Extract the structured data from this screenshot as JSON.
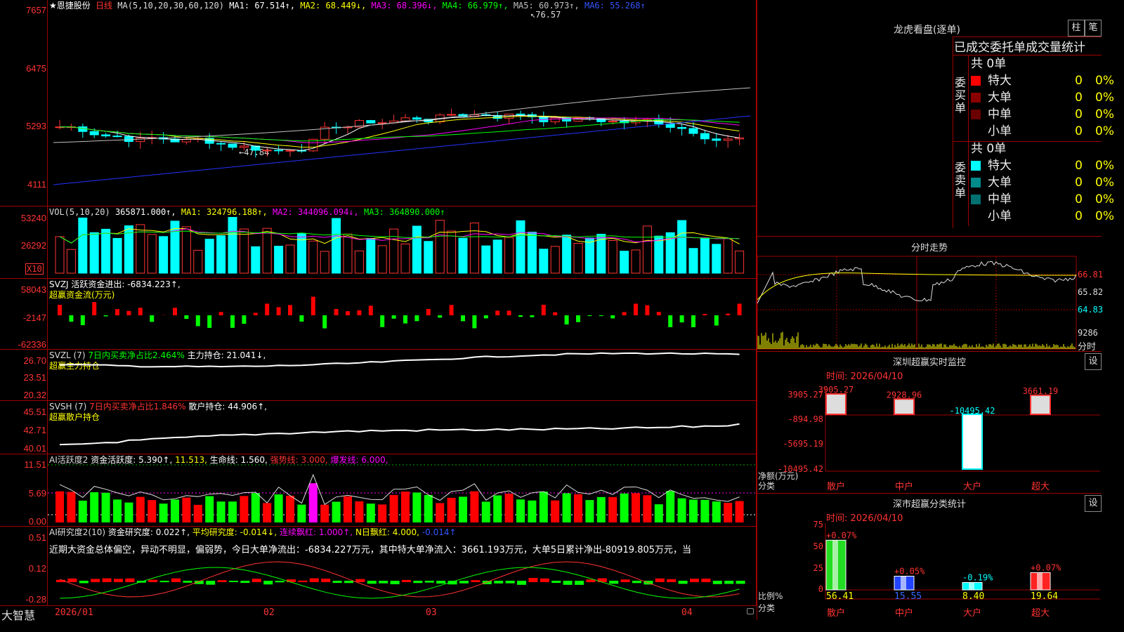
{
  "stock": {
    "name": "★恩捷股份",
    "period": "日线",
    "ma_label": "MA(5,10,20,30,60,120)",
    "ma": [
      {
        "label": "MA1: 67.514↑,",
        "color": "#ffffff"
      },
      {
        "label": "MA2: 68.449↓,",
        "color": "#ffff00"
      },
      {
        "label": "MA3: 68.396↓,",
        "color": "#ff00ff"
      },
      {
        "label": "MA4: 66.979↑,",
        "color": "#00ff00"
      },
      {
        "label": "MA5: 60.973↑,",
        "color": "#c0c0c0"
      },
      {
        "label": "MA6: 55.268↑",
        "color": "#0000ff"
      }
    ],
    "high_marker": "76.57",
    "low_marker": "47.84",
    "price_axis": [
      "7657",
      "6475",
      "5293",
      "4111"
    ]
  },
  "vol": {
    "label": "VOL(5,10,20)",
    "value": "365871.000↑,",
    "ma1": "MA1: 324796.188↑,",
    "ma2": "MA2: 344096.094↓,",
    "ma3": "MA3: 364890.000↑",
    "axis": [
      "53240",
      "26292"
    ],
    "unit": "X10"
  },
  "svzj": {
    "label": "SVZJ  活跃资金进出: -6834.223↑,",
    "sub": "超赢资金流(万元)",
    "axis": [
      "58043",
      "-2147",
      "-62336"
    ]
  },
  "svzl": {
    "label": "SVZL (7)",
    "net": "7日内买卖净占比2.464%",
    "hold": "主力持仓: 21.041↓,",
    "sub": "超赢主力持仓",
    "axis": [
      "26.70",
      "23.51",
      "20.32"
    ]
  },
  "svsh": {
    "label": "SVSH (7)",
    "net": "7日内买卖净占比1.846%",
    "hold": "散户持仓: 44.906↑,",
    "sub": "超赢散户持仓",
    "axis": [
      "45.51",
      "42.71",
      "40.01"
    ]
  },
  "ai_active": {
    "label": "AI活跃度2",
    "v1": "资金活跃度: 5.390↑,",
    "v2": "11.513,",
    "v3": "生命线: 1.560,",
    "v4": "强势线: 3.000,",
    "v5": "爆发线: 6.000,",
    "axis": [
      "11.51",
      "5.69",
      "0.00"
    ]
  },
  "ai_research": {
    "label": "AI研究度2(10)",
    "v1": "资金研究度: 0.022↑,",
    "v2": "平均研究度: -0.014↓,",
    "v3": "连续飘红: 1.000↑,",
    "v4": "N日飘红: 4.000,",
    "v5": "-0.014↑",
    "comment": "近期大资金总体偏空，异动不明显，偏弱势，今日大单净流出：-6834.227万元，其中特大单净流入：3661.193万元，大单5日累计净出-80919.805万元，当",
    "axis": [
      "0.51",
      "0.12",
      "-0.28"
    ]
  },
  "footer": {
    "brand": "大智慧",
    "dates": [
      "2026/01",
      "02",
      "03",
      "04"
    ]
  },
  "dragon_tiger": {
    "title": "龙虎看盘(逐单)",
    "btn1": "柱",
    "btn2": "笔",
    "subtitle": "已成交委托单成交量统计",
    "buy_label": "委买单",
    "sell_label": "委卖单",
    "buy_total": "共 0单",
    "sell_total": "共 0单",
    "buy_rows": [
      {
        "name": "特大",
        "count": "0",
        "pct": "0%",
        "color": "#ff0000"
      },
      {
        "name": "大单",
        "count": "0",
        "pct": "0%",
        "color": "#8b0000"
      },
      {
        "name": "中单",
        "count": "0",
        "pct": "0%",
        "color": "#6b0000"
      },
      {
        "name": "小单",
        "count": "0",
        "pct": "0%",
        "color": ""
      }
    ],
    "sell_rows": [
      {
        "name": "特大",
        "count": "0",
        "pct": "0%",
        "color": "#00ffff"
      },
      {
        "name": "大单",
        "count": "0",
        "pct": "0%",
        "color": "#008b8b"
      },
      {
        "name": "中单",
        "count": "0",
        "pct": "0%",
        "color": "#007070"
      },
      {
        "name": "小单",
        "count": "0",
        "pct": "0%",
        "color": ""
      }
    ]
  },
  "intraday": {
    "title": "分时走势",
    "axis": [
      "66.81",
      "65.82",
      "64.83"
    ],
    "vol": "9286",
    "unit": "分时"
  },
  "monitor": {
    "title": "深圳超赢实时监控",
    "btn": "设",
    "time": "时间: 2026/04/10",
    "axis": [
      "3905.27",
      "-894.98",
      "-5695.19",
      "-10495.42"
    ],
    "ylabel": "净额(万元)",
    "xlabel": "分类",
    "categories": [
      "散户",
      "中户",
      "大户",
      "超大"
    ],
    "values": [
      "3905.27",
      "2928.96",
      "-10495.42",
      "3661.19"
    ]
  },
  "classify": {
    "title": "深市超赢分类统计",
    "btn": "设",
    "time": "时间: 2026/04/10",
    "axis": [
      "75",
      "50",
      "25",
      "0"
    ],
    "ylabel": "比例%",
    "xlabel": "分类",
    "categories": [
      "散户",
      "中户",
      "大户",
      "超大"
    ],
    "changes": [
      "+0.07%",
      "+0.05%",
      "-0.19%",
      "+0.07%"
    ],
    "values": [
      "56.41",
      "15.55",
      "8.40",
      "19.64"
    ]
  }
}
